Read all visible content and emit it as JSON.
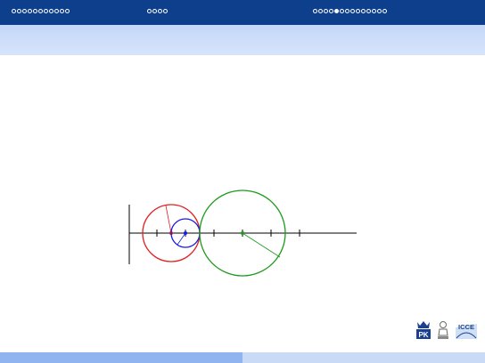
{
  "navigation": {
    "sections": [
      {
        "dots": 11,
        "current": -1
      },
      {
        "dots": 4,
        "current": -1
      },
      {
        "dots": 14,
        "current": 4
      }
    ]
  },
  "colors": {
    "header_bg": "#0d3f8c",
    "subheader_bg": "#cfdffa",
    "footer_left": "#8fb4ef",
    "footer_right": "#c8daf6",
    "red_circle": "#e02020",
    "blue_circle": "#1a1adf",
    "green_circle": "#1c9a1c"
  },
  "logos": {
    "pk_text": "PK",
    "icce_text": "ICCE"
  }
}
